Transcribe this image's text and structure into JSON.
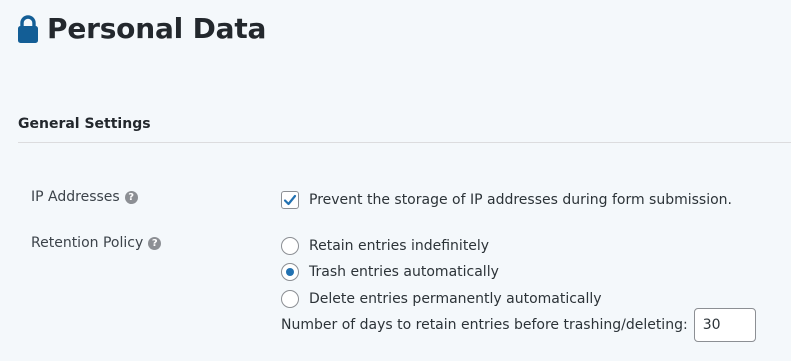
{
  "page": {
    "title": "Personal Data",
    "icon": "lock-icon"
  },
  "section": {
    "title": "General Settings"
  },
  "ip_addresses": {
    "label": "IP Addresses",
    "help_glyph": "?",
    "checkbox_label": "Prevent the storage of IP addresses during form submission.",
    "checked": true
  },
  "retention": {
    "label": "Retention Policy",
    "help_glyph": "?",
    "options": [
      {
        "label": "Retain entries indefinitely",
        "selected": false
      },
      {
        "label": "Trash entries automatically",
        "selected": true
      },
      {
        "label": "Delete entries permanently automatically",
        "selected": false
      }
    ],
    "days_label": "Number of days to retain entries before trashing/deleting:",
    "days_value": "30"
  },
  "colors": {
    "accent": "#2271b1",
    "lock": "#135e96",
    "background": "#f4f8fb"
  }
}
